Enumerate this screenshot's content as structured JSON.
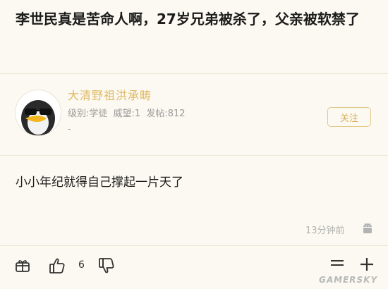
{
  "post": {
    "title": "李世民真是苦命人啊，27岁兄弟被杀了，父亲被软禁了"
  },
  "user": {
    "name": "大清野祖洪承畴",
    "level_label": "级别:学徒",
    "prestige_label": "威望:1",
    "posts_label": "发帖:812",
    "dash": "-",
    "follow_label": "关注"
  },
  "comment": {
    "text": "小小年纪就得自己撑起一片天了",
    "time": "13分钟前"
  },
  "actions": {
    "like_count": "6",
    "gift_icon": "gift-icon",
    "like_icon": "thumbs-up-icon",
    "dislike_icon": "thumbs-down-icon",
    "menu_icon": "menu-icon",
    "add_icon": "plus-icon"
  },
  "watermark": "GAMERSKY",
  "colors": {
    "background": "#fbf9f1",
    "accent": "#e0b964",
    "muted": "#9a9a9a"
  }
}
